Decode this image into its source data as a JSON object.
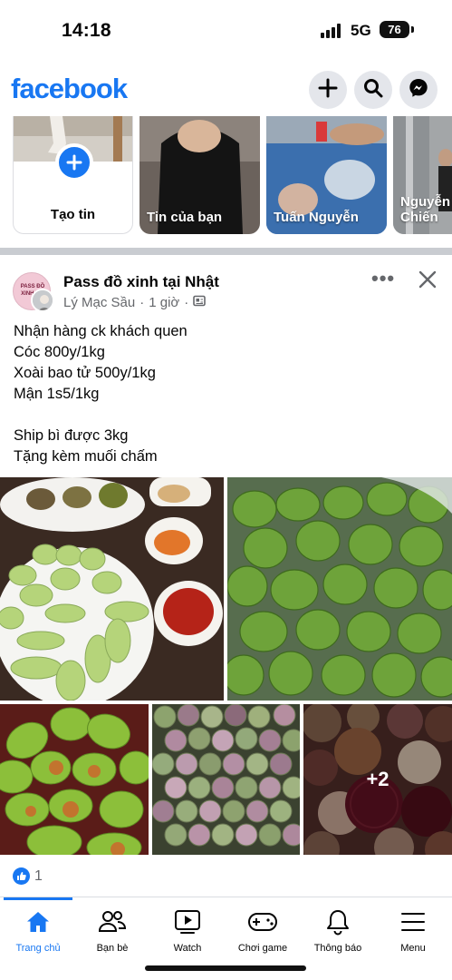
{
  "status_bar": {
    "time": "14:18",
    "network": "5G",
    "battery": "76"
  },
  "header": {
    "logo": "facebook",
    "icons": [
      "plus-icon",
      "search-icon",
      "messenger-icon"
    ],
    "brand_color": "#1877f2"
  },
  "stories": [
    {
      "label": "Tạo tin"
    },
    {
      "label": "Tin của bạn"
    },
    {
      "label": "Tuấn Nguyễn"
    },
    {
      "label": "Nguyễn Chiến"
    }
  ],
  "post": {
    "group_avatar_text": "PASS ĐỒ XINH TẠI",
    "group_name": "Pass đồ xinh tại Nhật",
    "author": "Lý Mạc Sầu",
    "separator": "·",
    "time": "1 giờ",
    "more_label": "•••",
    "text_lines": [
      "Nhận hàng ck khách quen",
      "Cóc 800y/1kg",
      "Xoài bao tử 500y/1kg",
      "Mận 1s5/1kg",
      "",
      "Ship bì được 3kg",
      "Tặng kèm muối chấm"
    ],
    "extra_photos": "+2",
    "reaction_count": "1"
  },
  "nav": {
    "items": [
      {
        "label": "Trang chủ",
        "icon": "home-icon",
        "active": true
      },
      {
        "label": "Bạn bè",
        "icon": "friends-icon",
        "active": false
      },
      {
        "label": "Watch",
        "icon": "watch-icon",
        "active": false
      },
      {
        "label": "Chơi game",
        "icon": "gaming-icon",
        "active": false
      },
      {
        "label": "Thông báo",
        "icon": "bell-icon",
        "active": false
      },
      {
        "label": "Menu",
        "icon": "menu-icon",
        "active": false
      }
    ]
  }
}
